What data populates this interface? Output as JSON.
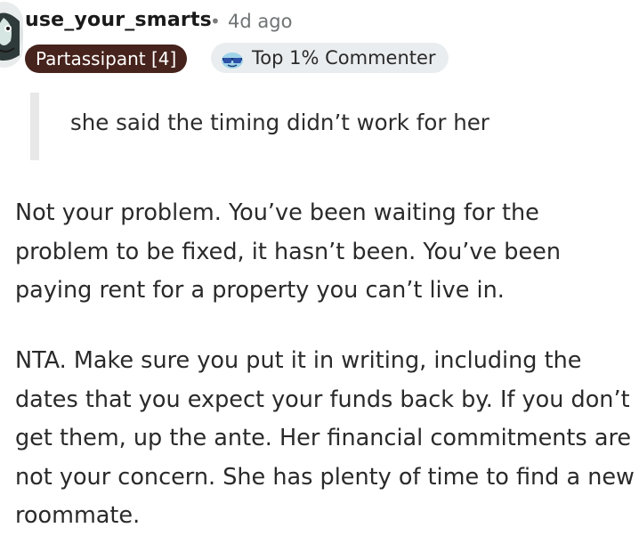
{
  "comment": {
    "author": "use_your_smarts",
    "separator": "•",
    "timestamp": "4d ago",
    "flair": "Partassipant [4]",
    "badge": {
      "label": "Top 1% Commenter",
      "icon": "sunglasses-icon"
    },
    "quote": "she said the timing didn’t work for her",
    "paragraphs": [
      "Not your problem. You’ve been waiting for the problem to be fixed, it hasn’t been. You’ve been paying rent for a property you can’t live in.",
      "NTA. Make sure you put it in writing, including the dates that you expect your funds back by. If you don’t get them, up the ante. Her financial commitments are not your concern. She has plenty of time to find a new roommate."
    ]
  },
  "colors": {
    "flair_bg": "#46231c",
    "badge_bg": "#eaedef",
    "quote_bar": "#e8e8e8"
  }
}
